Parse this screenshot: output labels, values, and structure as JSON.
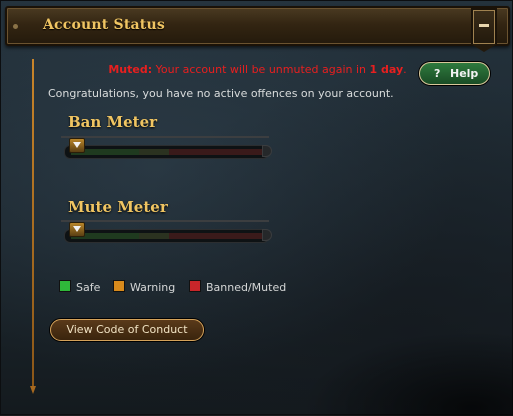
{
  "header": {
    "title": "Account Status",
    "collapse_icon": "minus-icon"
  },
  "status": {
    "muted_label": "Muted:",
    "muted_message": "Your account will be unmuted again in",
    "muted_duration": "1 day",
    "muted_end": ".",
    "congrats": "Congratulations, you have no active offences on your account."
  },
  "help_button": {
    "icon": "?",
    "label": "Help"
  },
  "ban_meter": {
    "title": "Ban Meter",
    "level": 0
  },
  "mute_meter": {
    "title": "Mute Meter",
    "level": 0
  },
  "legend": {
    "safe": "Safe",
    "warning": "Warning",
    "banned": "Banned/Muted"
  },
  "colors": {
    "safe": "#2fb83a",
    "warning": "#d88a1c",
    "banned": "#c8262a",
    "muted_text": "#e81f1f",
    "title_gold": "#f0c562"
  },
  "conduct_button": {
    "label": "View Code of Conduct"
  }
}
